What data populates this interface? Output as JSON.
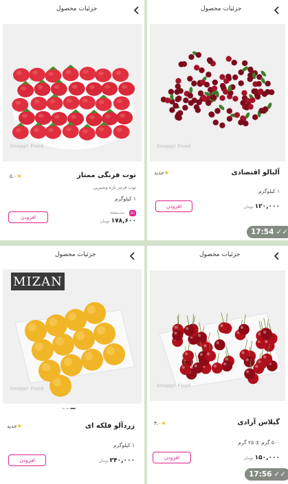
{
  "header_title": "جزئیات محصول",
  "watermark": "Snapp! Food",
  "add_label": "افزودن",
  "currency": "تومان",
  "logo_text": "MIZAN",
  "time_top": "17:54",
  "time_bottom": "17:56",
  "products": {
    "strawberry": {
      "name": "توت فرنگی ممتاز",
      "rating": "۵.۰",
      "desc": "توت قرمز تازه وشیرین",
      "unit": "۱ کیلوگرم",
      "old_price": "۱۸۸,۰۰۰",
      "discount": "۵٪",
      "price": "۱۷۸,۶۰۰"
    },
    "sourcherry": {
      "name": "آلبالو اقتصادی",
      "badge": "جدید",
      "unit": "۱ کیلوگرم",
      "price": "۱۲۰,۰۰۰"
    },
    "apricot": {
      "name": "زردآلو فلکه ای",
      "badge": "جدید",
      "unit": "۱ کیلوگرم",
      "price": "۲۴۰,۰۰۰"
    },
    "cherry": {
      "name": "گیلاس آزادی",
      "rating": "۴.۰",
      "unit": "۵۰۰ گرم ± ۲۵ گرم",
      "price": "۱۵۰,۰۰۰"
    }
  },
  "colors": {
    "accent": "#e0208a",
    "background": "#d4e2cc"
  }
}
